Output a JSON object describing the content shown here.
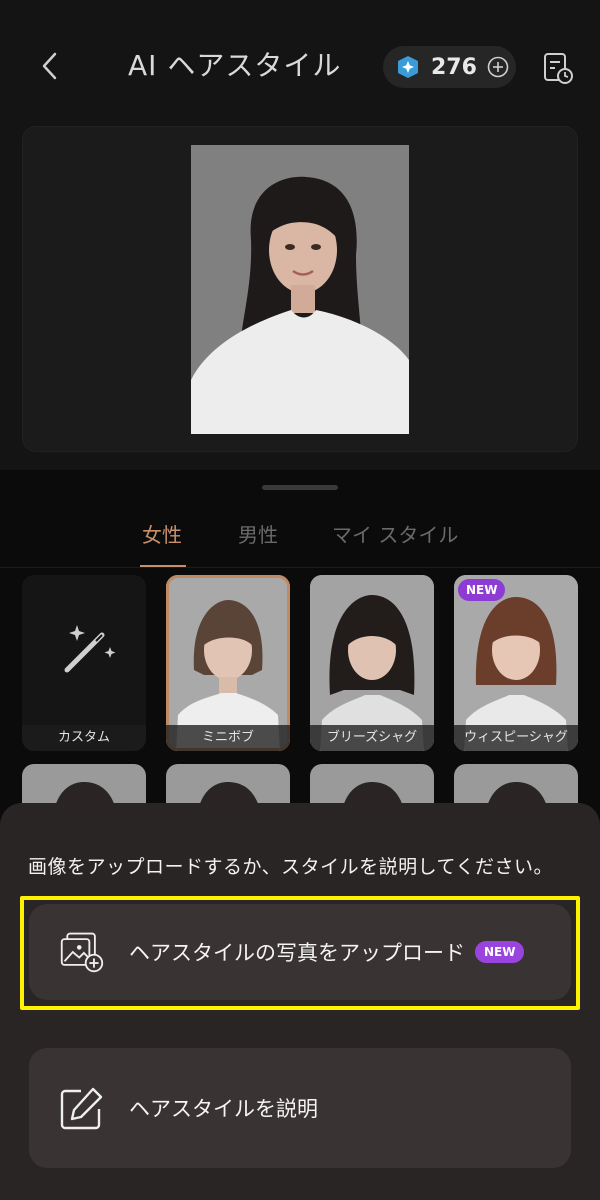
{
  "header": {
    "title": "AI ヘアスタイル",
    "credits": "276"
  },
  "tabs": [
    {
      "label": "女性",
      "active": true
    },
    {
      "label": "男性",
      "active": false
    },
    {
      "label": "マイ スタイル",
      "active": false
    }
  ],
  "styles": [
    {
      "label": "カスタム"
    },
    {
      "label": "ミニボブ",
      "selected": true
    },
    {
      "label": "ブリーズシャグ"
    },
    {
      "label": "ウィスピーシャグ",
      "badge": "NEW"
    }
  ],
  "sheet": {
    "prompt": "画像をアップロードするか、スタイルを説明してください。",
    "upload_label": "ヘアスタイルの写真をアップロード",
    "upload_badge": "NEW",
    "describe_label": "ヘアスタイルを説明"
  },
  "colors": {
    "accent": "#c8906a",
    "highlight": "#fff200",
    "badge": "#9a44e0"
  }
}
